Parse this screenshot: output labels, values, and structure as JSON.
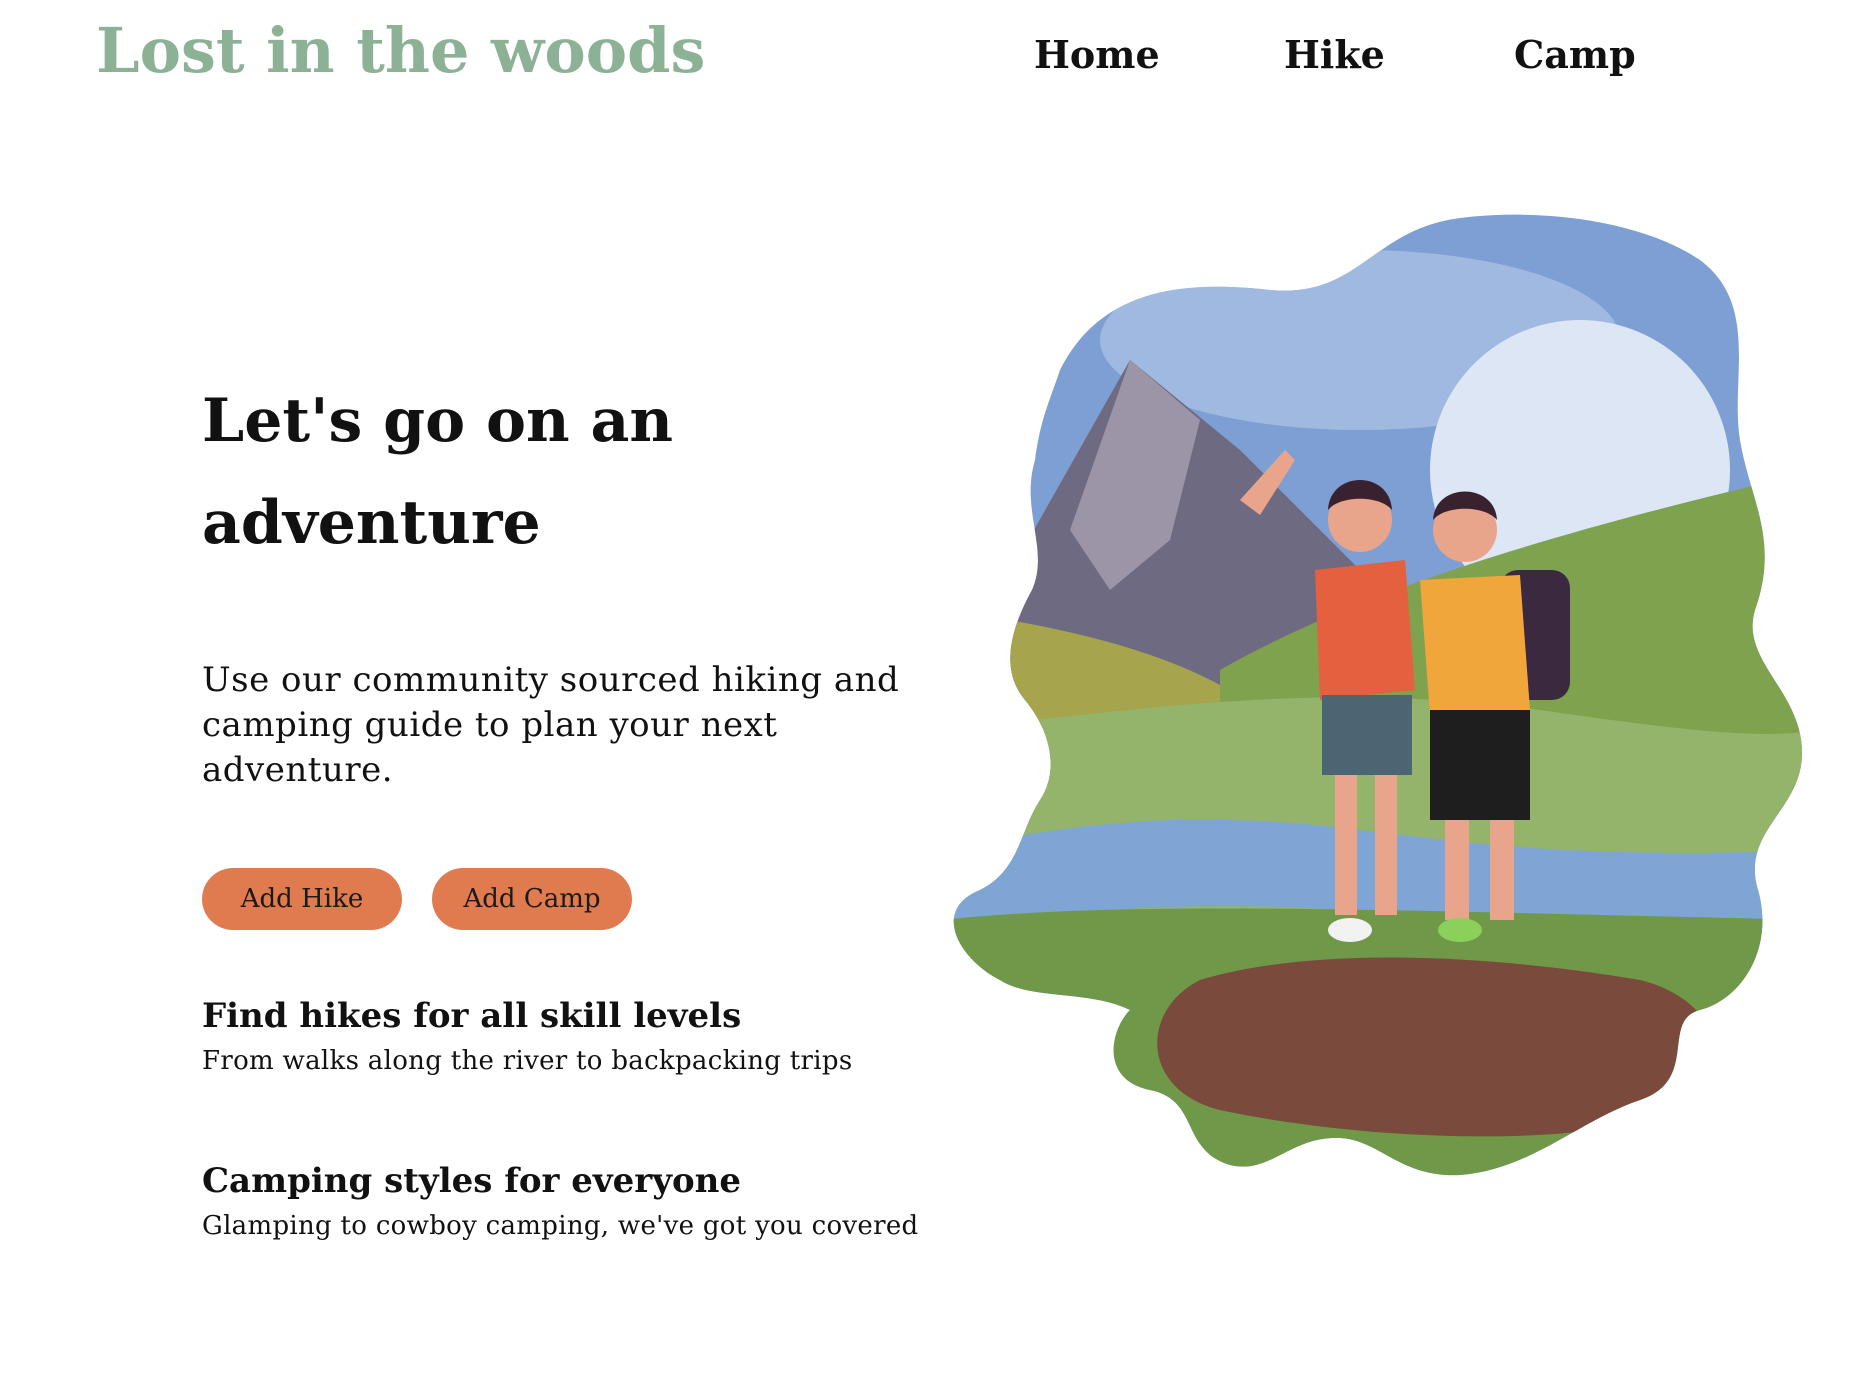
{
  "header": {
    "brand": "Lost in the woods",
    "nav": [
      "Home",
      "Hike",
      "Camp"
    ]
  },
  "hero": {
    "title_line1": "Let's go on an",
    "title_line2": "adventure",
    "description": "Use our community sourced hiking and camping guide to plan your next adventure.",
    "buttons": {
      "add_hike": "Add Hike",
      "add_camp": "Add Camp"
    }
  },
  "features": [
    {
      "title": "Find hikes for all skill levels",
      "subtitle": "From walks along the river to backpacking trips"
    },
    {
      "title": "Camping styles for everyone",
      "subtitle": "Glamping to cowboy camping, we've got you covered"
    }
  ],
  "illustration": {
    "name": "hikers-mountain-illustration"
  },
  "colors": {
    "brand": "#8cb195",
    "button": "#e07a4f",
    "sky": "#7e9fd3",
    "mountain": "#6e6a82",
    "grass": "#7fa24f",
    "river": "#7ea5d4",
    "trail": "#7a4a3d"
  }
}
